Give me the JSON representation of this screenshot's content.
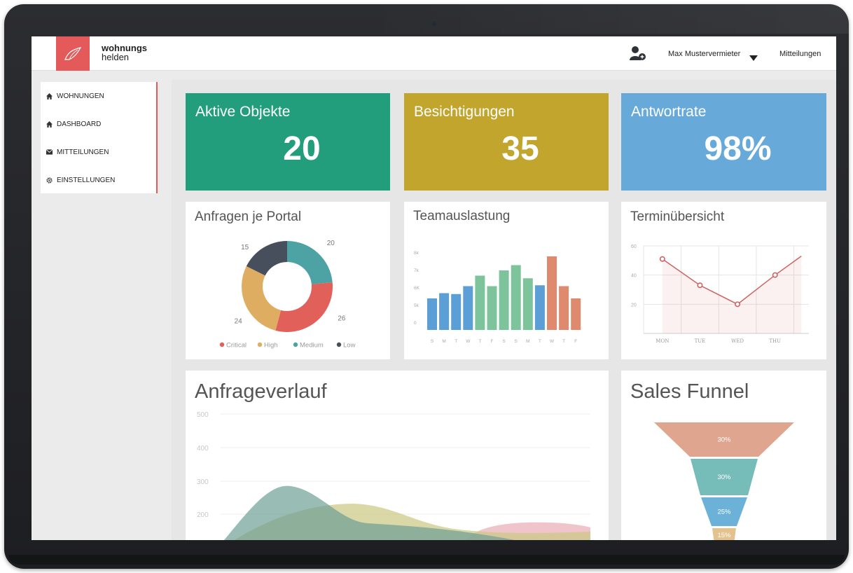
{
  "brand": {
    "line1": "wohnungs",
    "line2": "helden"
  },
  "topbar": {
    "user_name": "Max Mustervermieter",
    "messages": "Mitteilungen"
  },
  "sidebar": {
    "items": [
      {
        "label": "WOHNUNGEN",
        "icon": "home-icon"
      },
      {
        "label": "DASHBOARD",
        "icon": "home-icon"
      },
      {
        "label": "MITTEILUNGEN",
        "icon": "envelope-icon"
      },
      {
        "label": "EINSTELLUNGEN",
        "icon": "gear-icon"
      }
    ]
  },
  "stats": [
    {
      "title": "Aktive Objekte",
      "value": "20",
      "color": "#229e7d"
    },
    {
      "title": "Besichtigungen",
      "value": "35",
      "color": "#c1a52c"
    },
    {
      "title": "Antwortrate",
      "value": "98%",
      "color": "#67aada"
    }
  ],
  "colors": {
    "accent": "#e45a5a"
  },
  "chart_data": [
    {
      "type": "pie",
      "title": "Anfragen je Portal",
      "categories": [
        "Critical",
        "High",
        "Medium",
        "Low"
      ],
      "values": [
        26,
        24,
        20,
        15
      ],
      "colors": [
        "#e2605a",
        "#dfad62",
        "#4da3a4",
        "#474e5c"
      ],
      "legend": "bottom"
    },
    {
      "type": "bar",
      "title": "Teamauslastung",
      "categories": [
        "S",
        "M",
        "T",
        "W",
        "T",
        "F",
        "S",
        "S",
        "M",
        "T",
        "W",
        "T",
        "F"
      ],
      "y_ticks": [
        "0",
        "5k",
        "6K",
        "7k",
        "8k"
      ],
      "values": [
        5.8,
        6.1,
        6.05,
        6.5,
        7.1,
        6.5,
        7.4,
        7.7,
        6.95,
        6.55,
        8.2,
        6.5,
        5.8
      ],
      "colors": [
        "#5b9fd6",
        "#5b9fd6",
        "#5b9fd6",
        "#5b9fd6",
        "#7dc49c",
        "#7dc49c",
        "#7dc49c",
        "#7dc49c",
        "#7dc49c",
        "#5b9fd6",
        "#df8a6e",
        "#df8a6e",
        "#df8a6e"
      ],
      "ylim": [
        4,
        8.8
      ]
    },
    {
      "type": "line",
      "title": "Terminübersicht",
      "categories": [
        "MON",
        "TUE",
        "WED",
        "THU"
      ],
      "y_ticks": [
        "20",
        "40",
        "60"
      ],
      "x": [
        0.5,
        1.5,
        2.5,
        3.5,
        4.2
      ],
      "values": [
        51,
        33,
        20,
        40,
        53
      ],
      "ylim": [
        0,
        60
      ],
      "color": "#cf6363"
    },
    {
      "type": "area",
      "title": "Anfrageverlauf",
      "y_ticks": [
        "200",
        "300",
        "400",
        "500"
      ],
      "ylim": [
        100,
        500
      ]
    },
    {
      "type": "funnel",
      "title": "Sales Funnel",
      "values": [
        "30%",
        "30%",
        "25%",
        "15%"
      ],
      "colors": [
        "#dfa58e",
        "#76bcb8",
        "#6cb2d8",
        "#e4c28e"
      ]
    }
  ]
}
